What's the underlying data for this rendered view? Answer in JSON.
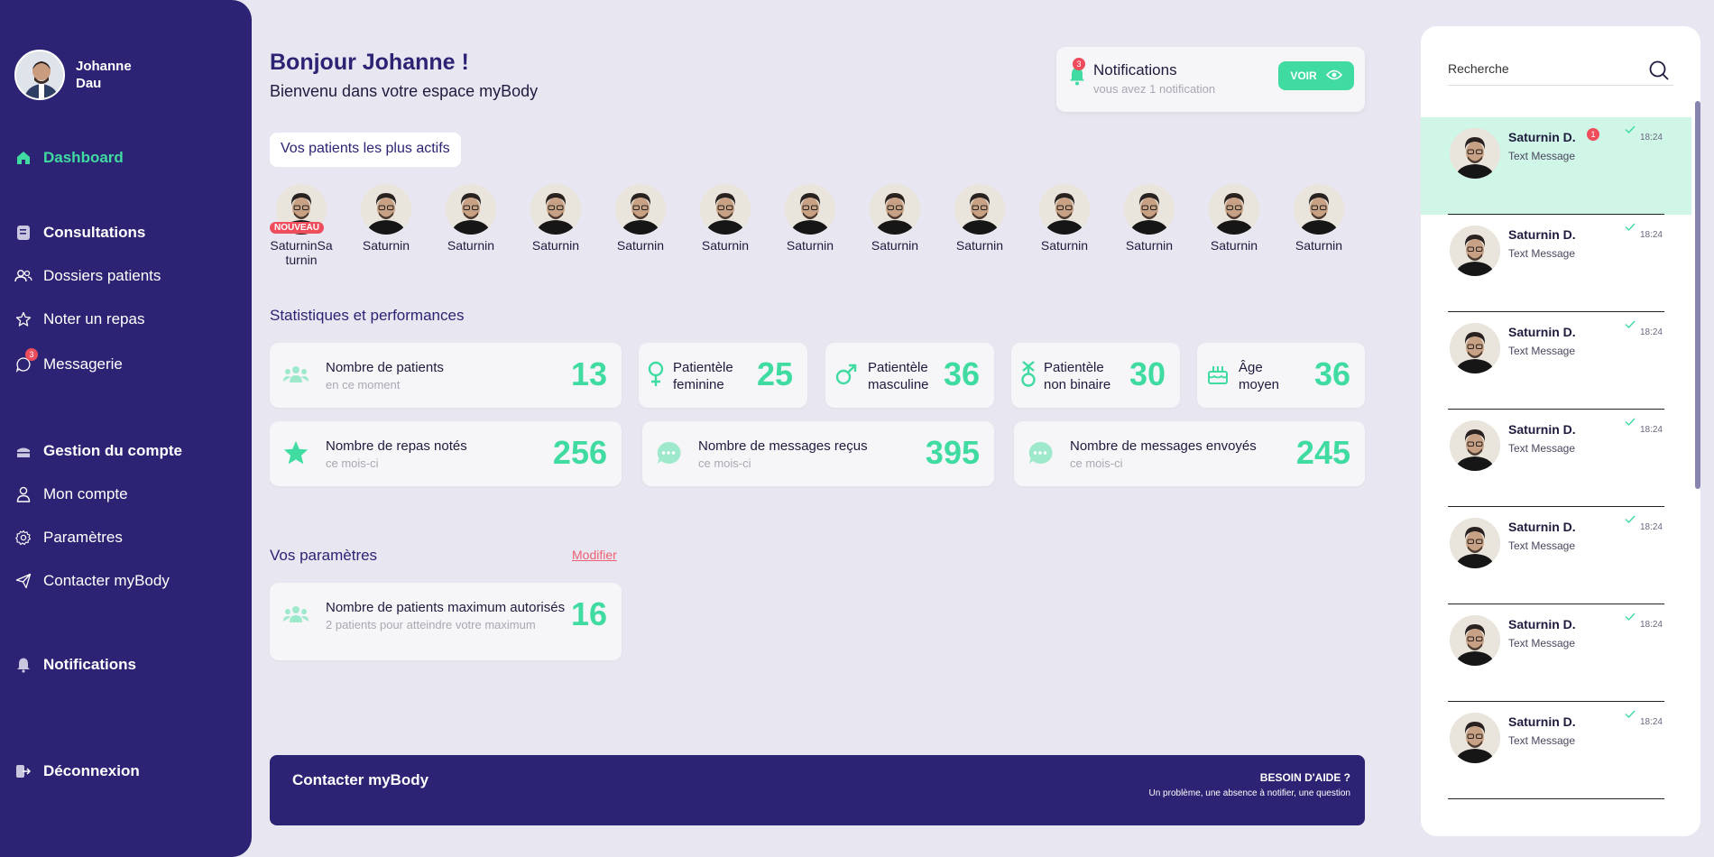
{
  "colors": {
    "sidebar": "#2c2374",
    "accent": "#3fdba1",
    "badge": "#ef4d5c",
    "background": "#e8e7f1"
  },
  "user": {
    "name": "Johanne Dau"
  },
  "sidebar": {
    "dashboard": "Dashboard",
    "consultations": "Consultations",
    "dossiers": "Dossiers patients",
    "noter": "Noter un repas",
    "messagerie": "Messagerie",
    "messagerie_badge": "3",
    "gestion": "Gestion du compte",
    "mon_compte": "Mon compte",
    "parametres": "Paramètres",
    "contacter": "Contacter myBody",
    "notifications": "Notifications",
    "deconnexion": "Déconnexion"
  },
  "header": {
    "title": "Bonjour Johanne !",
    "subtitle": "Bienvenu dans votre espace myBody"
  },
  "notifications": {
    "badge": "3",
    "title": "Notifications",
    "subtitle": "vous avez 1 notification",
    "button": "VOIR"
  },
  "active_patients": {
    "title": "Vos patients les plus actifs",
    "new_label": "NOUVEAU",
    "items": [
      "SaturninSaturnin",
      "Saturnin",
      "Saturnin",
      "Saturnin",
      "Saturnin",
      "Saturnin",
      "Saturnin",
      "Saturnin",
      "Saturnin",
      "Saturnin",
      "Saturnin",
      "Saturnin",
      "Saturnin"
    ]
  },
  "stats": {
    "title": "Statistiques et performances",
    "patients": {
      "label": "Nombre de patients",
      "sub": "en ce moment",
      "value": "13"
    },
    "feminine": {
      "label1": "Patientèle",
      "label2": "feminine",
      "value": "25"
    },
    "masculine": {
      "label1": "Patientèle",
      "label2": "masculine",
      "value": "36"
    },
    "non_binaire": {
      "label1": "Patientèle",
      "label2": "non binaire",
      "value": "30"
    },
    "age": {
      "label1": "Âge",
      "label2": "moyen",
      "value": "36"
    },
    "repas": {
      "label": "Nombre de repas notés",
      "sub": "ce mois-ci",
      "value": "256"
    },
    "recus": {
      "label": "Nombre de messages reçus",
      "sub": "ce mois-ci",
      "value": "395"
    },
    "envoyes": {
      "label": "Nombre de messages envoyés",
      "sub": "ce mois-ci",
      "value": "245"
    }
  },
  "settings": {
    "title": "Vos paramètres",
    "edit": "Modifier",
    "max": {
      "label": "Nombre de patients maximum autorisés",
      "sub": "2 patients pour atteindre votre maximum",
      "value": "16"
    }
  },
  "contact": {
    "title": "Contacter myBody",
    "help": "BESOIN D'AIDE ?",
    "help_sub": "Un problème, une absence à notifier, une question"
  },
  "messages": {
    "search_placeholder": "Recherche",
    "items": [
      {
        "name": "Saturnin D.",
        "text": "Text Message",
        "time": "18:24",
        "badge": "1"
      },
      {
        "name": "Saturnin D.",
        "text": "Text Message",
        "time": "18:24"
      },
      {
        "name": "Saturnin D.",
        "text": "Text Message",
        "time": "18:24"
      },
      {
        "name": "Saturnin D.",
        "text": "Text Message",
        "time": "18:24"
      },
      {
        "name": "Saturnin D.",
        "text": "Text Message",
        "time": "18:24"
      },
      {
        "name": "Saturnin D.",
        "text": "Text Message",
        "time": "18:24"
      },
      {
        "name": "Saturnin D.",
        "text": "Text Message",
        "time": "18:24"
      }
    ]
  }
}
